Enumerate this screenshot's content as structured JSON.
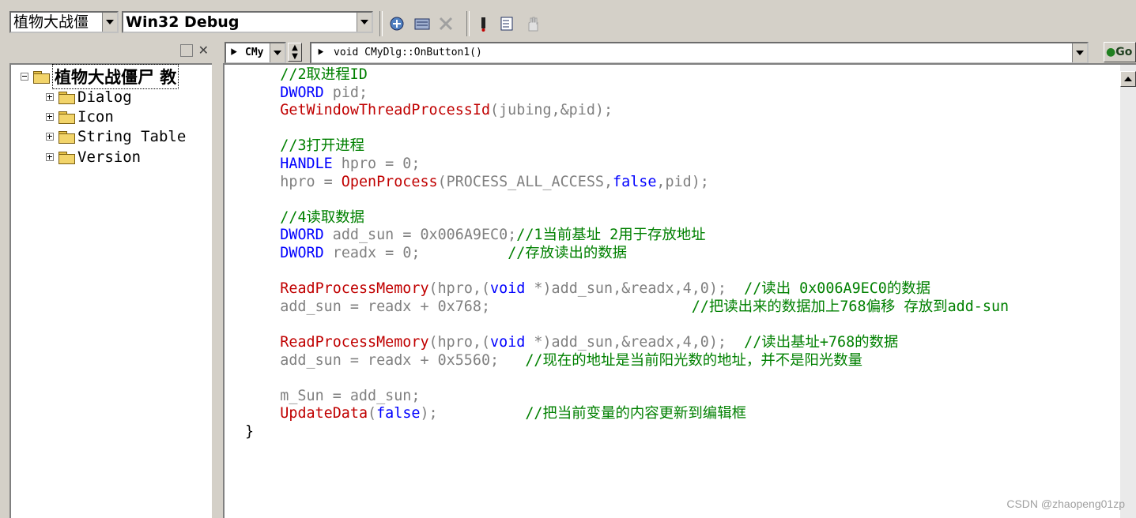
{
  "toolbar": {
    "project_combo": "植物大战僵",
    "config_combo": "Win32 Debug"
  },
  "tree": {
    "root": "植物大战僵尸 教",
    "items": [
      "Dialog",
      "Icon",
      "String Table",
      "Version"
    ]
  },
  "nav": {
    "class_combo": "CMy",
    "function_combo": "void CMyDlg::OnButton1()",
    "go_label": "Go"
  },
  "code": {
    "lines": [
      [
        {
          "t": "    "
        },
        {
          "t": "//2取进程ID",
          "c": "c"
        }
      ],
      [
        {
          "t": "    "
        },
        {
          "t": "DWORD",
          "c": "k"
        },
        {
          "t": " pid;"
        }
      ],
      [
        {
          "t": "    "
        },
        {
          "t": "GetWindowThreadProcessId",
          "c": "f"
        },
        {
          "t": "(jubing,&pid);"
        }
      ],
      [
        {
          "t": ""
        }
      ],
      [
        {
          "t": "    "
        },
        {
          "t": "//3打开进程",
          "c": "c"
        }
      ],
      [
        {
          "t": "    "
        },
        {
          "t": "HANDLE",
          "c": "k"
        },
        {
          "t": " hpro = 0;"
        }
      ],
      [
        {
          "t": "    hpro = "
        },
        {
          "t": "OpenProcess",
          "c": "f"
        },
        {
          "t": "(PROCESS_ALL_ACCESS,"
        },
        {
          "t": "false",
          "c": "k"
        },
        {
          "t": ",pid);"
        }
      ],
      [
        {
          "t": ""
        }
      ],
      [
        {
          "t": "    "
        },
        {
          "t": "//4读取数据",
          "c": "c"
        }
      ],
      [
        {
          "t": "    "
        },
        {
          "t": "DWORD",
          "c": "k"
        },
        {
          "t": " add_sun = 0x006A9EC0;"
        },
        {
          "t": "//1当前基址 2用于存放地址",
          "c": "c"
        }
      ],
      [
        {
          "t": "    "
        },
        {
          "t": "DWORD",
          "c": "k"
        },
        {
          "t": " readx = 0;          "
        },
        {
          "t": "//存放读出的数据",
          "c": "c"
        }
      ],
      [
        {
          "t": ""
        }
      ],
      [
        {
          "t": "    "
        },
        {
          "t": "ReadProcessMemory",
          "c": "f"
        },
        {
          "t": "(hpro,("
        },
        {
          "t": "void",
          "c": "k"
        },
        {
          "t": " *)add_sun,&readx,4,0);  "
        },
        {
          "t": "//读出 0x006A9EC0的数据",
          "c": "c"
        }
      ],
      [
        {
          "t": "    add_sun = readx + 0x768;                       "
        },
        {
          "t": "//把读出来的数据加上768偏移 存放到add-sun",
          "c": "c"
        }
      ],
      [
        {
          "t": ""
        }
      ],
      [
        {
          "t": "    "
        },
        {
          "t": "ReadProcessMemory",
          "c": "f"
        },
        {
          "t": "(hpro,("
        },
        {
          "t": "void",
          "c": "k"
        },
        {
          "t": " *)add_sun,&readx,4,0);  "
        },
        {
          "t": "//读出基址+768的数据",
          "c": "c"
        }
      ],
      [
        {
          "t": "    add_sun = readx + 0x5560;   "
        },
        {
          "t": "//现在的地址是当前阳光数的地址，并不是阳光数量",
          "c": "c"
        }
      ],
      [
        {
          "t": ""
        }
      ],
      [
        {
          "t": "    m_Sun = add_sun;"
        }
      ],
      [
        {
          "t": "    "
        },
        {
          "t": "UpdateData",
          "c": "f"
        },
        {
          "t": "("
        },
        {
          "t": "false",
          "c": "k"
        },
        {
          "t": ");          "
        },
        {
          "t": "//把当前变量的内容更新到编辑框",
          "c": "c"
        }
      ],
      [
        {
          "t": "}",
          "c": "b"
        }
      ]
    ]
  },
  "watermark": "CSDN @zhaopeng01zp",
  "icons": {
    "toolbar": [
      "compile-icon",
      "build-icon",
      "stop-build-icon",
      "debug-run-icon",
      "insert-breakpoint-icon",
      "hand-icon"
    ]
  }
}
